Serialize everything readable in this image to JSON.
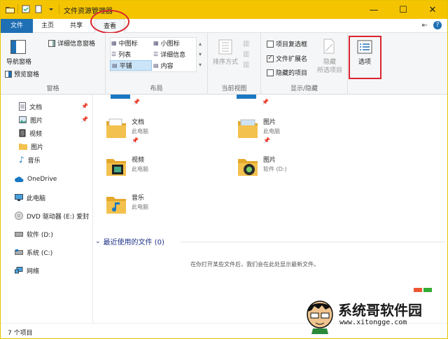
{
  "title": "文件资源管理器",
  "tabs": {
    "file": "文件",
    "home": "主页",
    "share": "共享",
    "view": "查看"
  },
  "ribbon": {
    "panes": {
      "nav_pane": "导航窗格",
      "preview_pane": "预览窗格",
      "details_pane": "详细信息窗格",
      "label": "窗格"
    },
    "layout": {
      "medium_icons": "中图标",
      "small_icons": "小图标",
      "list": "列表",
      "details": "详细信息",
      "tiles": "平铺",
      "content": "内容",
      "label": "布局"
    },
    "current_view": {
      "sort_by": "排序方式",
      "label": "当前视图"
    },
    "show_hide": {
      "item_checkboxes": "项目复选框",
      "item_checkboxes_checked": false,
      "file_extensions": "文件扩展名",
      "file_extensions_checked": true,
      "hidden_items": "隐藏的项目",
      "hidden_items_checked": false,
      "hide_selected": "隐藏",
      "hide_selected_2": "所选项目",
      "label": "显示/隐藏"
    },
    "options": "选项"
  },
  "sidebar": {
    "items": [
      {
        "label": "文档",
        "pinned": true
      },
      {
        "label": "图片",
        "pinned": true
      },
      {
        "label": "视频",
        "pinned": false
      },
      {
        "label": "图片",
        "pinned": false
      },
      {
        "label": "音乐",
        "pinned": false
      },
      {
        "label": "OneDrive"
      },
      {
        "label": "此电脑"
      },
      {
        "label": "DVD 驱动器 (E:) 爱封"
      },
      {
        "label": "软件 (D:)"
      },
      {
        "label": "系统 (C:)"
      },
      {
        "label": "网络"
      }
    ]
  },
  "main": {
    "tiles": [
      {
        "name": "文档",
        "sub": "此电脑"
      },
      {
        "name": "图片",
        "sub": "此电脑"
      },
      {
        "name": "视频",
        "sub": "此电脑"
      },
      {
        "name": "图片",
        "sub": "软件 (D:)"
      },
      {
        "name": "音乐",
        "sub": "此电脑"
      }
    ],
    "recent_header": "最近使用的文件 (0)",
    "empty_message": "在你打开某些文件后，我们会在此处显示最新文件。"
  },
  "status": {
    "item_count": "7 个项目"
  },
  "watermark": {
    "title": "系统哥软件园",
    "url": "www.xitongge.com"
  },
  "colors": {
    "titlebar": "#f5c400",
    "file_tab": "#1f6fb5",
    "highlight": "#d9262f",
    "folder": "#f2c14e"
  }
}
